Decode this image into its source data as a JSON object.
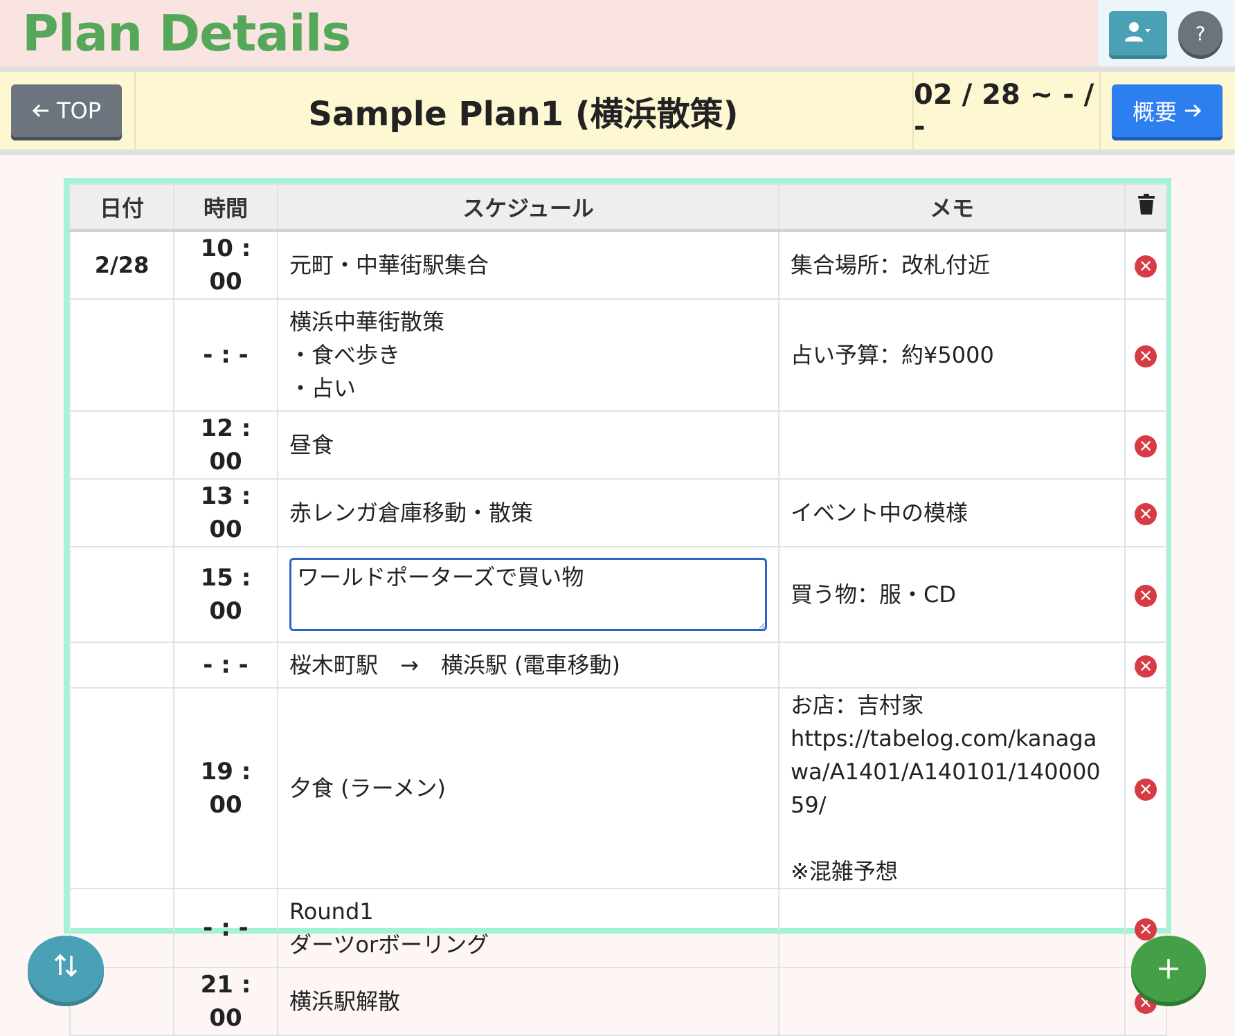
{
  "header": {
    "title": "Plan Details",
    "user_button_icon": "user-dropdown-icon",
    "help_label": "?"
  },
  "planbar": {
    "top_label": "TOP",
    "top_icon": "arrow-left-icon",
    "plan_name": "Sample Plan1 (横浜散策)",
    "dates": "02 / 28 ~ - / -",
    "summary_label": "概要",
    "summary_icon": "arrow-right-icon"
  },
  "table": {
    "headers": {
      "date": "日付",
      "time": "時間",
      "schedule": "スケジュール",
      "memo": "メモ",
      "delete_icon": "trash-icon"
    },
    "rows": [
      {
        "date": "2/28",
        "time": "10 : 00",
        "schedule": "元町・中華街駅集合",
        "memo": "集合場所：改札付近"
      },
      {
        "date": "",
        "time": "- : -",
        "schedule": "横浜中華街散策\n・食べ歩き\n・占い",
        "memo": "占い予算：約¥5000"
      },
      {
        "date": "",
        "time": "12 : 00",
        "schedule": "昼食",
        "memo": ""
      },
      {
        "date": "",
        "time": "13 : 00",
        "schedule": "赤レンガ倉庫移動・散策",
        "memo": "イベント中の模様"
      },
      {
        "date": "",
        "time": "15 : 00",
        "schedule": "ワールドポーターズで買い物",
        "memo": "買う物：服・CD",
        "editing": true
      },
      {
        "date": "",
        "time": "- : -",
        "schedule": "桜木町駅　→　横浜駅 (電車移動)",
        "memo": ""
      },
      {
        "date": "",
        "time": "19 : 00",
        "schedule": "夕食 (ラーメン)",
        "memo": "お店：吉村家\nhttps://tabelog.com/kanagawa/A1401/A140101/14000059/\n\n※混雑予想"
      },
      {
        "date": "",
        "time": "- : -",
        "schedule": "Round1\nダーツorボーリング",
        "memo": ""
      },
      {
        "date": "",
        "time": "21 : 00",
        "schedule": "横浜駅解散",
        "memo": ""
      }
    ]
  },
  "fab": {
    "sort_icon": "sort-icon",
    "add_icon": "plus-icon"
  },
  "colors": {
    "title": "#55a85a",
    "header_bg": "#f9e4e2",
    "planbar_bg": "#fdf7d2",
    "table_border": "#a3f3d7",
    "primary": "#2d7ff0",
    "info": "#4aa1b6",
    "success": "#43a047",
    "danger": "#d73b43"
  }
}
